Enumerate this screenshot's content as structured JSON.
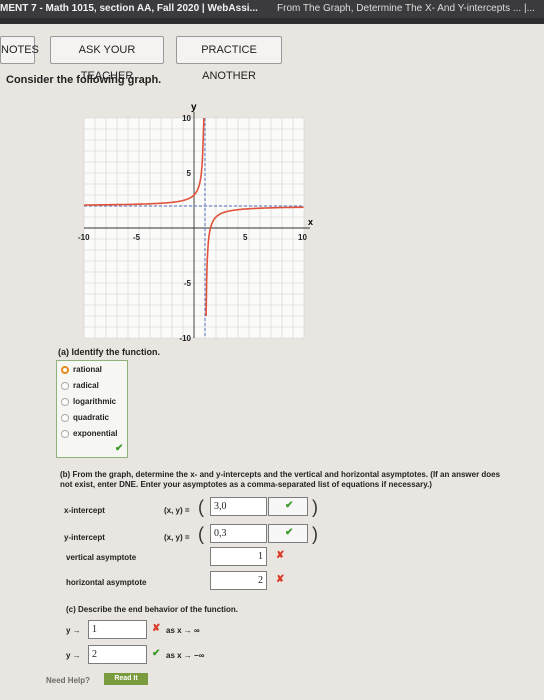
{
  "browser": {
    "tab_active": "MENT 7 - Math 1015, section AA, Fall 2020 | WebAssi...",
    "tab_other": "From The Graph, Determine The X- And Y-intercepts ... |..."
  },
  "toolbar": {
    "notes_label": "NOTES",
    "ask_label": "ASK YOUR TEACHER",
    "practice_label": "PRACTICE ANOTHER"
  },
  "question": {
    "prompt": "Consider the following graph."
  },
  "graph": {
    "y_axis_label": "y",
    "x_axis_label": "x",
    "x_ticks": [
      "-10",
      "-5",
      "5",
      "10"
    ],
    "y_ticks": [
      "10",
      "5",
      "-5",
      "-10"
    ]
  },
  "chart_data": {
    "type": "line",
    "xlim": [
      -10,
      10
    ],
    "ylim": [
      -10,
      10
    ],
    "vertical_asymptote": 1,
    "horizontal_asymptote": 2,
    "series": [
      {
        "x": [
          -10,
          -8,
          -6,
          -4,
          -2,
          -1,
          -0.5,
          0,
          0.3,
          0.5,
          0.7,
          0.8
        ],
        "y": [
          2.27,
          2.33,
          2.43,
          2.6,
          3.0,
          3.5,
          4.0,
          3.0,
          3.57,
          4.0,
          5.0,
          5.5
        ]
      }
    ]
  },
  "part_a": {
    "title": "(a) Identify the function.",
    "options": [
      "rational",
      "radical",
      "logarithmic",
      "quadratic",
      "exponential"
    ],
    "status": "✔"
  },
  "part_b": {
    "instructions": "(b) From the graph, determine the x- and y-intercepts and the vertical and horizontal asymptotes. (If an answer does not exist, enter DNE. Enter your asymptotes as a comma-separated list of equations if necessary.)",
    "xy_label": "(x, y) =",
    "x_intercept_label": "x-intercept",
    "x_intercept_value": "3,0",
    "x_intercept_status": "✔",
    "y_intercept_label": "y-intercept",
    "y_intercept_value": "0,3",
    "y_intercept_status": "✔",
    "vertical_label": "vertical asymptote",
    "vertical_value": "1",
    "vertical_status": "✘",
    "horizontal_label": "horizontal asymptote",
    "horizontal_value": "2",
    "horizontal_status": "✘"
  },
  "part_c": {
    "title": "(c) Describe the end behavior of the function.",
    "row1_prefix": "y →",
    "row1_value": "1",
    "row1_status": "✘",
    "row1_suffix": "as x → ∞",
    "row2_prefix": "y →",
    "row2_value": "2",
    "row2_status": "✔",
    "row2_suffix": "as x → −∞"
  },
  "help": {
    "need_help": "Need Help?",
    "read_it": "Read It"
  }
}
